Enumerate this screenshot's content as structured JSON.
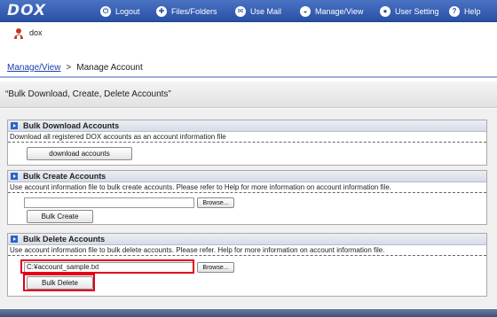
{
  "app": {
    "logo": "DOX"
  },
  "nav": {
    "items": [
      {
        "icon": "logout-icon",
        "glyph": "⏻",
        "label": "Logout"
      },
      {
        "icon": "files-icon",
        "glyph": "✚",
        "label": "Files/Folders"
      },
      {
        "icon": "mail-icon",
        "glyph": "✉",
        "label": "Use Mail"
      },
      {
        "icon": "manage-icon",
        "glyph": "◒",
        "label": "Manage/View"
      },
      {
        "icon": "user-setting-icon",
        "glyph": "●",
        "label": "User Setting"
      },
      {
        "icon": "help-icon",
        "glyph": "?",
        "label": "Help"
      }
    ]
  },
  "user": {
    "name": "dox"
  },
  "breadcrumb": {
    "parent": "Manage/View",
    "separator": ">",
    "current": "Manage Account"
  },
  "page": {
    "title": "“Bulk Download, Create, Delete Accounts”"
  },
  "panels": {
    "download": {
      "title": "Bulk Download Accounts",
      "description": "Download all registered DOX accounts as an account information file",
      "button": "download accounts"
    },
    "create": {
      "title": "Bulk Create Accounts",
      "description": "Use account information file to bulk create accounts. Please refer to Help for more information on account information file.",
      "file_value": "",
      "browse": "Browse...",
      "button": "Bulk Create"
    },
    "delete": {
      "title": "Bulk Delete Accounts",
      "description": "Use account information file to bulk delete accounts. Please refer. Help for more information on account information file.",
      "file_value": "C:¥account_sample.txt",
      "browse": "Browse...",
      "button": "Bulk Delete"
    }
  },
  "colors": {
    "nav": "#2a50a5",
    "highlight": "#e3001b",
    "link": "#1a3fa8"
  }
}
